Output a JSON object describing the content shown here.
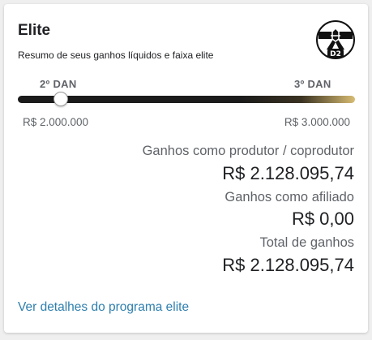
{
  "card": {
    "title": "Elite",
    "subtitle": "Resumo de seus ganhos líquidos e faixa elite",
    "badge_icon": "black-belt-dan-2-icon",
    "badge_text": "D2"
  },
  "progress": {
    "from_level": "2º DAN",
    "to_level": "3º DAN",
    "min_label": "R$ 2.000.000",
    "max_label": "R$ 3.000.000",
    "fraction": 0.128,
    "colors": {
      "track_dark": "#1b1b1b",
      "track_gold": "#d7bc72"
    }
  },
  "earnings": {
    "producer_label": "Ganhos como produtor / coprodutor",
    "producer_value": "R$ 2.128.095,74",
    "affiliate_label": "Ganhos como afiliado",
    "affiliate_value": "R$ 0,00",
    "total_label": "Total de ganhos",
    "total_value": "R$ 2.128.095,74"
  },
  "footer": {
    "link_label": "Ver detalhes do programa elite",
    "link_color": "#2e7fae"
  }
}
